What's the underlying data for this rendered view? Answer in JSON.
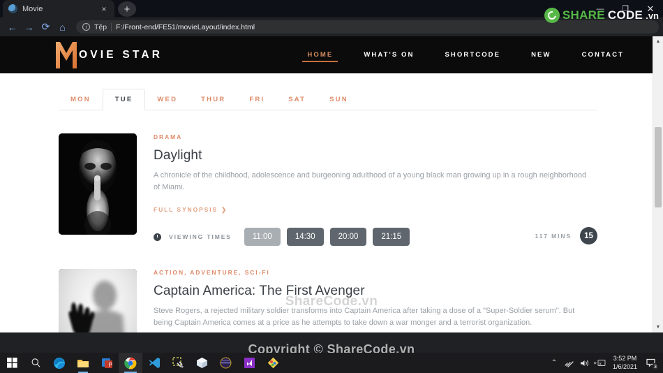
{
  "browser": {
    "tab": {
      "title": "Movie",
      "favicon_icon": "globe-icon",
      "close_icon": "×"
    },
    "new_tab_label": "+",
    "window_controls": {
      "minimize": "—",
      "maximize": "❐",
      "close": "✕"
    },
    "nav": {
      "back": "←",
      "forward": "→",
      "reload": "⟳",
      "home": "⌂"
    },
    "omnibox": {
      "info_icon": "ⓘ",
      "scheme_label": "Tệp",
      "url": "F:/Front-end/FE51/movieLayout/index.html"
    }
  },
  "site": {
    "logo": {
      "mark": "M",
      "text": "OVIE  STAR",
      "accent": "#e07b39"
    },
    "nav_items": [
      {
        "label": "HOME",
        "active": true
      },
      {
        "label": "WHAT'S ON",
        "active": false
      },
      {
        "label": "SHORTCODE",
        "active": false
      },
      {
        "label": "NEW",
        "active": false
      },
      {
        "label": "CONTACT",
        "active": false
      }
    ],
    "days": [
      {
        "label": "MON",
        "active": false
      },
      {
        "label": "TUE",
        "active": true
      },
      {
        "label": "WED",
        "active": false
      },
      {
        "label": "THUR",
        "active": false
      },
      {
        "label": "FRI",
        "active": false
      },
      {
        "label": "SAT",
        "active": false
      },
      {
        "label": "SUN",
        "active": false
      }
    ],
    "labels": {
      "synopsis": "FULL SYNOPSIS",
      "synopsis_arrow": "❯",
      "viewing_times": "VIEWING TIMES"
    },
    "movies": [
      {
        "genre": "DRAMA",
        "title": "Daylight",
        "description": "A chronicle of the childhood, adolescence and burgeoning adulthood of a young black man growing up in a rough neighborhood of Miami.",
        "poster_icon": "shushing-face-poster",
        "times": [
          {
            "time": "11:00",
            "highlighted": true
          },
          {
            "time": "14:30",
            "highlighted": false
          },
          {
            "time": "20:00",
            "highlighted": false
          },
          {
            "time": "21:15",
            "highlighted": false
          }
        ],
        "duration": "117 MINS",
        "rating": "15"
      },
      {
        "genre": "ACTION, ADVENTURE, SCI-FI",
        "title": "Captain America: The First Avenger",
        "description": "Steve Rogers, a rejected military soldier transforms into Captain America after taking a dose of a \"Super-Soldier serum\". But being Captain America comes at a price as he attempts to take down a war monger and a terrorist organization.",
        "poster_icon": "hands-on-glass-poster",
        "times": [],
        "duration": "",
        "rating": ""
      }
    ]
  },
  "watermarks": {
    "center": "ShareCode.vn",
    "copyright": "Copyright © ShareCode.vn",
    "logo": {
      "share": "SHARE",
      "code": "CODE",
      "tld": ".vn",
      "green": "#57b847"
    }
  },
  "taskbar": {
    "icons": [
      {
        "name": "start-button",
        "glyph": "⊞"
      },
      {
        "name": "search-button",
        "glyph": "🔍"
      },
      {
        "name": "edge-icon",
        "glyph": "e"
      },
      {
        "name": "file-explorer-icon",
        "glyph": "📁"
      },
      {
        "name": "office-icon",
        "glyph": "▤"
      },
      {
        "name": "chrome-icon",
        "glyph": "◎"
      },
      {
        "name": "vscode-icon",
        "glyph": "⌁"
      },
      {
        "name": "tools-icon",
        "glyph": "⚒"
      },
      {
        "name": "cube-icon",
        "glyph": "▣"
      },
      {
        "name": "circle-app-icon",
        "glyph": "◍"
      },
      {
        "name": "visual-studio-icon",
        "glyph": "∞"
      },
      {
        "name": "paint-icon",
        "glyph": "◈"
      }
    ],
    "tray": {
      "chevron": "⌃",
      "network_icon": "📶",
      "volume_icon": "🔊",
      "language_icon": "ENG",
      "time": "3:52 PM",
      "date": "1/6/2021",
      "notification_count": "3"
    }
  }
}
